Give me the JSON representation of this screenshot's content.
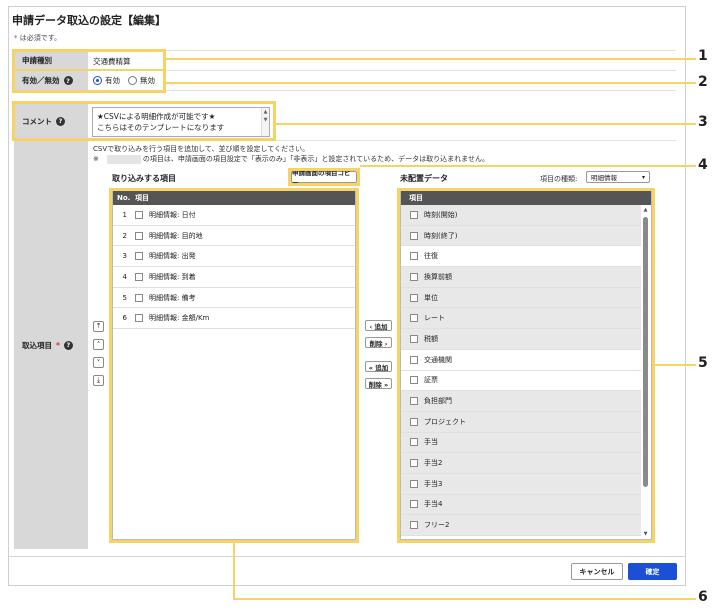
{
  "title": "申請データ取込の設定【編集】",
  "required_note": {
    "star": "*",
    "text": " は必須です。"
  },
  "fields": {
    "application_type": {
      "label": "申請種別",
      "value": "交通費精算"
    },
    "enabled": {
      "label": "有効／無効",
      "options": [
        "有効",
        "無効"
      ],
      "selected": "有効"
    },
    "comment": {
      "label": "コメント",
      "lines": [
        "★CSVによる明細作成が可能です★",
        "こちらはそのテンプレートになります"
      ]
    },
    "import_items": {
      "label": "取込項目",
      "required_star": "*"
    }
  },
  "import_note": {
    "line1": "CSVで取り込みを行う項目を追加して、並び順を設定してください。",
    "line2_prefix": "※",
    "line2_suffix": "の項目は、申請画面の項目設定で「表示のみ」「非表示」と設定されているため、データは取り込まれません。"
  },
  "left_table": {
    "heading": "取り込みする項目",
    "col_no": "No.",
    "col_item": "項目",
    "rows": [
      {
        "no": "1",
        "item": "明細情報: 日付"
      },
      {
        "no": "2",
        "item": "明細情報: 目的地"
      },
      {
        "no": "3",
        "item": "明細情報: 出発"
      },
      {
        "no": "4",
        "item": "明細情報: 到着"
      },
      {
        "no": "5",
        "item": "明細情報: 備考"
      },
      {
        "no": "6",
        "item": "明細情報: 金額/Km"
      }
    ]
  },
  "copy_button": "申請画面の項目コピー",
  "right_table": {
    "heading": "未配置データ",
    "type_label": "項目の種類:",
    "type_value": "明細情報",
    "col_item": "項目",
    "rows": [
      {
        "item": "時刻(開始)",
        "grey": true
      },
      {
        "item": "時刻(終了)",
        "grey": true
      },
      {
        "item": "往復",
        "grey": false
      },
      {
        "item": "換算前額",
        "grey": true
      },
      {
        "item": "単位",
        "grey": true
      },
      {
        "item": "レート",
        "grey": true
      },
      {
        "item": "税額",
        "grey": true
      },
      {
        "item": "交通機関",
        "grey": false
      },
      {
        "item": "証票",
        "grey": false
      },
      {
        "item": "負担部門",
        "grey": true
      },
      {
        "item": "プロジェクト",
        "grey": true
      },
      {
        "item": "手当",
        "grey": true
      },
      {
        "item": "手当2",
        "grey": true
      },
      {
        "item": "手当3",
        "grey": true
      },
      {
        "item": "手当4",
        "grey": true
      },
      {
        "item": "フリー2",
        "grey": true
      }
    ]
  },
  "move_buttons": {
    "add": "‹ 追加",
    "remove": "削除 ›",
    "add_all": "« 追加",
    "remove_all": "削除 »"
  },
  "order_buttons": [
    "⤒",
    "˄",
    "˅",
    "⤓"
  ],
  "footer": {
    "cancel": "キャンセル",
    "confirm": "確定"
  },
  "callouts": [
    "1",
    "2",
    "3",
    "4",
    "5",
    "6"
  ],
  "colors": {
    "highlight": "#f6d365",
    "header": "#555555",
    "primary": "#1a4fd6",
    "required": "#d9302c"
  }
}
